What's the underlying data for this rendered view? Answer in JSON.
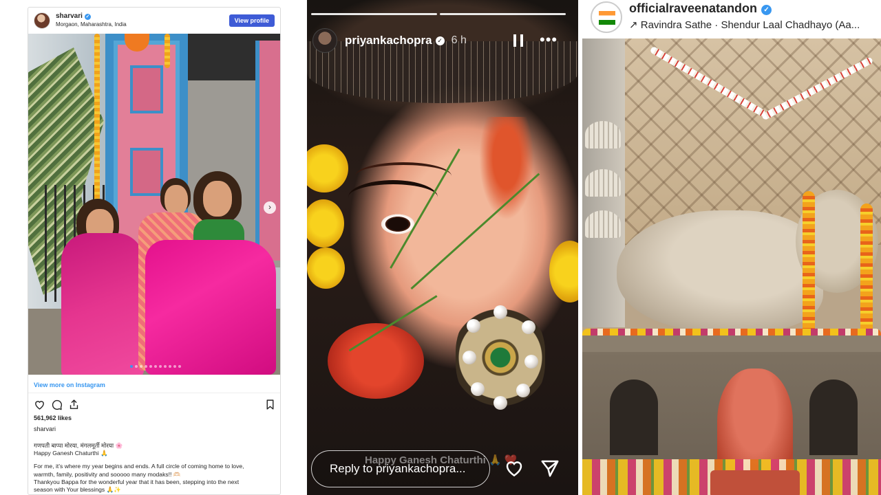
{
  "embed": {
    "username": "sharvari",
    "location": "Morgaon, Maharashtra, India",
    "view_profile": "View profile",
    "view_more": "View more on Instagram",
    "likes": "561,962 likes",
    "caption_user": "sharvari",
    "caption_lines": [
      "गणपती बाप्पा मोरया, मंगलमूर्ती मोरया 🌸",
      "Happy Ganesh Chaturthi 🙏",
      "",
      "For me, it’s where my year begins and ends. A full circle of coming home to love,",
      "warmth, family, positivity and sooooo many modaks!! 🫶🏻",
      "Thankyou Bappa for the wonderful year that it has been, stepping into the next",
      "season with Your blessings 🙏✨"
    ],
    "carousel_total": 11,
    "carousel_index": 0
  },
  "story": {
    "username": "priyankachopra",
    "time": "6 h",
    "caption": "Happy Ganesh Chaturthi 🙏 ❤️",
    "reply_placeholder": "Reply to priyankachopra...",
    "progress_segments": 2
  },
  "panel3": {
    "username": "officialraveenatandon",
    "music": "↗ Ravindra Sathe · Shendur Laal Chadhayo (Aa..."
  },
  "colors": {
    "ig_blue": "#3897f0",
    "view_profile_bg": "#3e5bd6",
    "text_dark": "#262626"
  },
  "icons": {
    "embed": [
      "heart-icon",
      "comment-icon",
      "share-icon",
      "bookmark-icon",
      "chevron-right-icon",
      "verified-icon"
    ],
    "story": [
      "verified-icon",
      "pause-icon",
      "more-icon",
      "heart-icon",
      "send-icon"
    ],
    "panel3": [
      "verified-icon",
      "music-arrow-icon"
    ]
  }
}
